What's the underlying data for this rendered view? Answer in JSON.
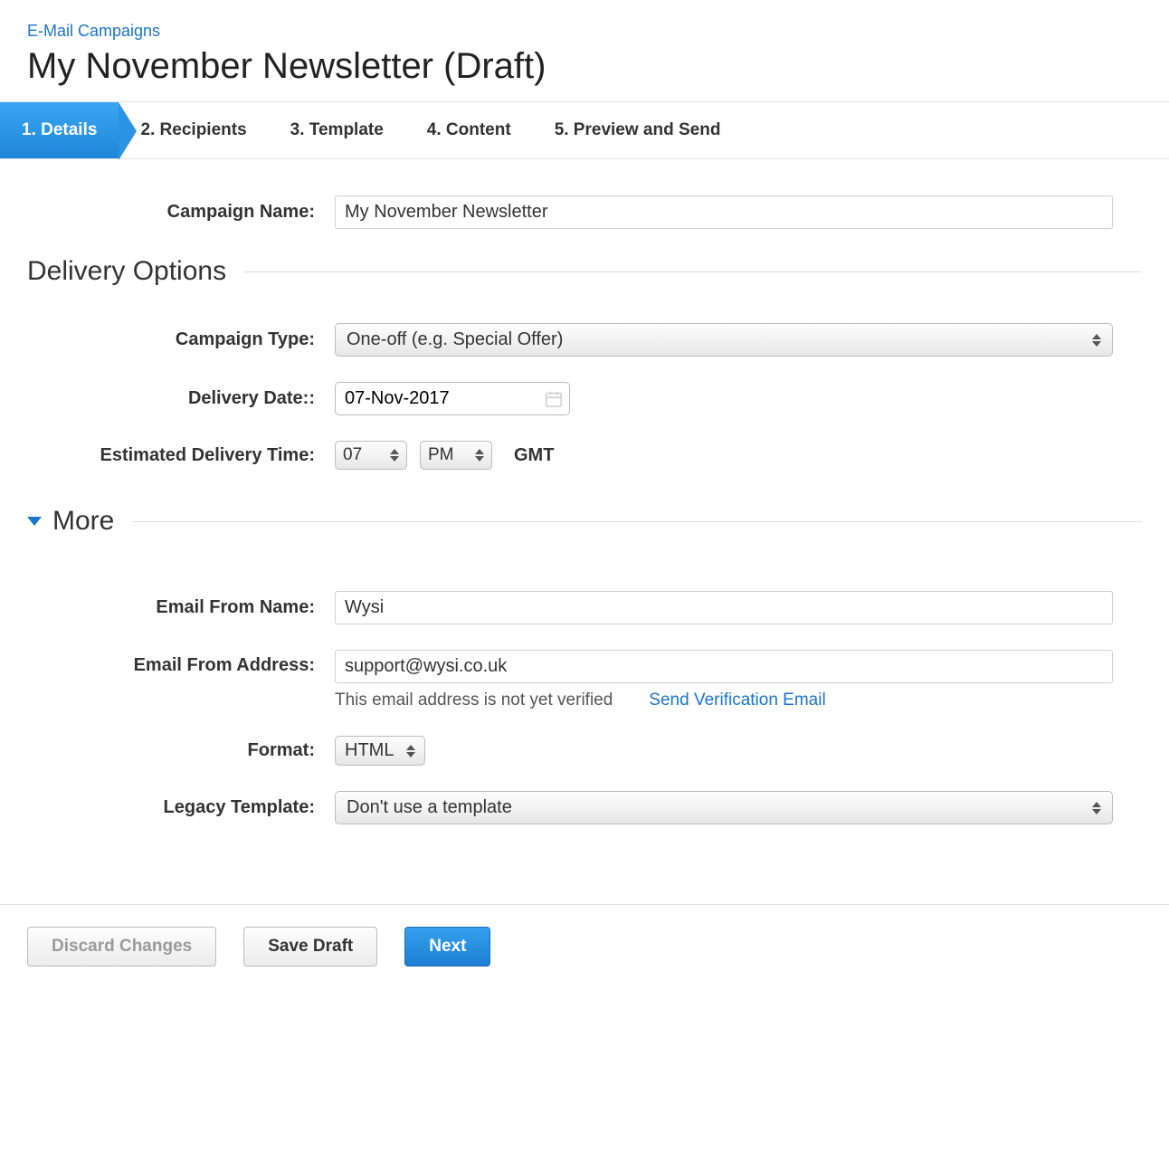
{
  "breadcrumb": {
    "link_label": "E-Mail Campaigns"
  },
  "page_title": "My November Newsletter (Draft)",
  "tabs": [
    {
      "label": "1. Details",
      "active": true
    },
    {
      "label": "2. Recipients",
      "active": false
    },
    {
      "label": "3. Template",
      "active": false
    },
    {
      "label": "4. Content",
      "active": false
    },
    {
      "label": "5. Preview and Send",
      "active": false
    }
  ],
  "form": {
    "campaign_name": {
      "label": "Campaign Name:",
      "value": "My November Newsletter"
    },
    "delivery_options_title": "Delivery Options",
    "campaign_type": {
      "label": "Campaign Type:",
      "value": "One-off (e.g. Special Offer)"
    },
    "delivery_date": {
      "label": "Delivery Date::",
      "value": "07-Nov-2017"
    },
    "estimated_time": {
      "label": "Estimated Delivery Time:",
      "hour": "07",
      "ampm": "PM",
      "tz": "GMT"
    },
    "more_title": "More",
    "from_name": {
      "label": "Email From Name:",
      "value": "Wysi"
    },
    "from_address": {
      "label": "Email From Address:",
      "value": "support@wysi.co.uk",
      "hint": "This email address is not yet verified",
      "verify_link": "Send Verification Email"
    },
    "format": {
      "label": "Format:",
      "value": "HTML"
    },
    "legacy_template": {
      "label": "Legacy Template:",
      "value": "Don't use a template"
    }
  },
  "footer": {
    "discard": "Discard Changes",
    "save": "Save Draft",
    "next": "Next"
  }
}
